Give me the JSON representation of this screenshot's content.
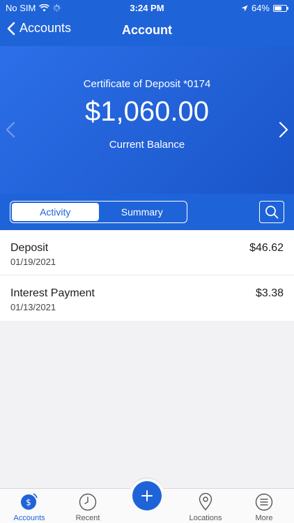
{
  "status_bar": {
    "carrier": "No SIM",
    "time": "3:24 PM",
    "battery": "64%",
    "battery_level": 0.64
  },
  "nav": {
    "back_label": "Accounts",
    "title": "Account"
  },
  "account": {
    "name": "Certificate of Deposit *0174",
    "balance": "$1,060.00",
    "balance_label": "Current Balance"
  },
  "tabs": [
    {
      "label": "Activity",
      "active": true
    },
    {
      "label": "Summary",
      "active": false
    }
  ],
  "transactions": [
    {
      "title": "Deposit",
      "date": "01/19/2021",
      "amount": "$46.62"
    },
    {
      "title": "Interest Payment",
      "date": "01/13/2021",
      "amount": "$3.38"
    }
  ],
  "tab_bar": {
    "items": [
      {
        "label": "Accounts",
        "icon": "accounts-dollar-icon",
        "active": true
      },
      {
        "label": "Recent",
        "icon": "clock-icon",
        "active": false
      },
      {
        "label": "",
        "icon": "plus-icon",
        "active": false
      },
      {
        "label": "Locations",
        "icon": "location-pin-icon",
        "active": false
      },
      {
        "label": "More",
        "icon": "menu-icon",
        "active": false
      }
    ]
  },
  "colors": {
    "brand_blue": "#1f63d8",
    "background": "#f2f2f4"
  }
}
